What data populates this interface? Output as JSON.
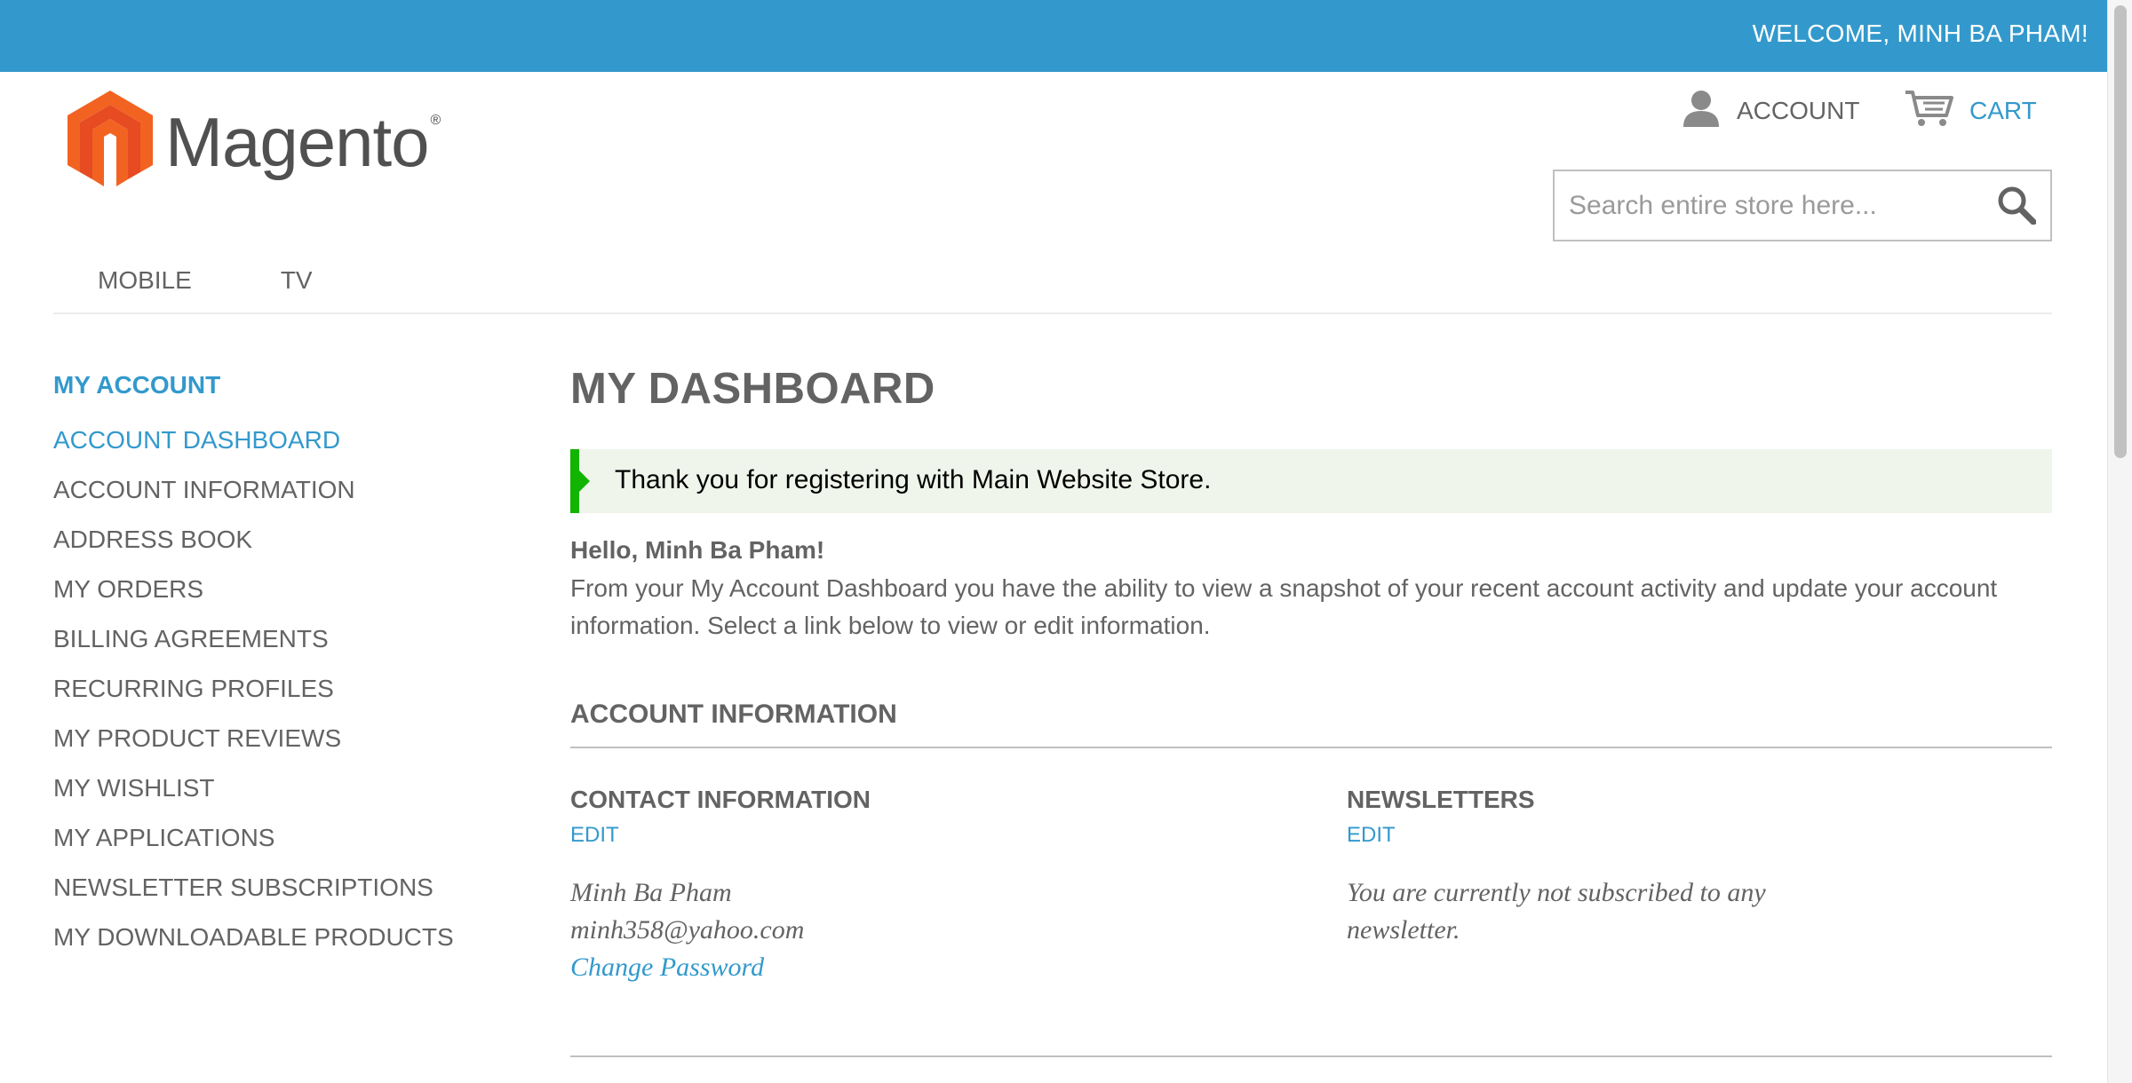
{
  "header": {
    "welcome": "WELCOME, MINH BA PHAM!",
    "brand_color": "#3399cc"
  },
  "logo": {
    "text": "Magento",
    "reg": "®",
    "icon": "magento-logo-icon",
    "colors": [
      "#f26322",
      "#e64b22"
    ]
  },
  "account_link": {
    "label": "ACCOUNT",
    "icon": "user-icon"
  },
  "cart_link": {
    "label": "CART",
    "icon": "cart-icon"
  },
  "search": {
    "placeholder": "Search entire store here...",
    "value": "",
    "icon": "search-icon"
  },
  "nav": {
    "items": [
      "MOBILE",
      "TV"
    ]
  },
  "sidebar": {
    "title": "MY ACCOUNT",
    "items": [
      {
        "label": "ACCOUNT DASHBOARD",
        "active": true
      },
      {
        "label": "ACCOUNT INFORMATION",
        "active": false
      },
      {
        "label": "ADDRESS BOOK",
        "active": false
      },
      {
        "label": "MY ORDERS",
        "active": false
      },
      {
        "label": "BILLING AGREEMENTS",
        "active": false
      },
      {
        "label": "RECURRING PROFILES",
        "active": false
      },
      {
        "label": "MY PRODUCT REVIEWS",
        "active": false
      },
      {
        "label": "MY WISHLIST",
        "active": false
      },
      {
        "label": "MY APPLICATIONS",
        "active": false
      },
      {
        "label": "NEWSLETTER SUBSCRIPTIONS",
        "active": false
      },
      {
        "label": "MY DOWNLOADABLE PRODUCTS",
        "active": false
      }
    ]
  },
  "main": {
    "title": "MY DASHBOARD",
    "success_message": "Thank you for registering with Main Website Store.",
    "success_color": "#11b400",
    "hello": "Hello, Minh Ba Pham!",
    "intro": "From your My Account Dashboard you have the ability to view a snapshot of your recent account activity and update your account information. Select a link below to view or edit information.",
    "account_info": {
      "title": "ACCOUNT INFORMATION",
      "contact": {
        "title": "CONTACT INFORMATION",
        "edit": "EDIT",
        "name": "Minh Ba Pham",
        "email": "minh358@yahoo.com",
        "change_password": "Change Password"
      },
      "newsletters": {
        "title": "NEWSLETTERS",
        "edit": "EDIT",
        "line1": "You are currently not subscribed to any",
        "line2": "newsletter."
      }
    }
  }
}
